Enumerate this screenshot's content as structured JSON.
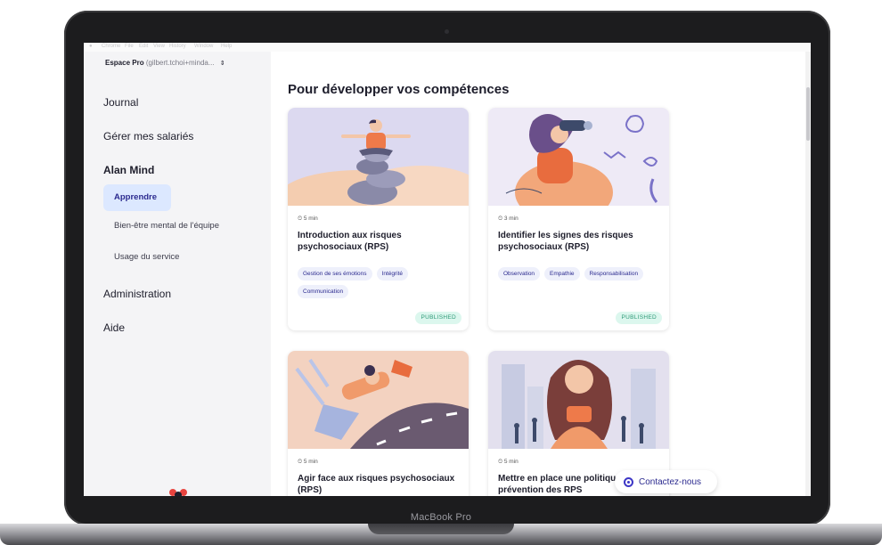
{
  "device": {
    "label": "MacBook Pro"
  },
  "menubar": {
    "items": [
      "Chrome",
      "File",
      "Edit",
      "View",
      "History",
      "Window",
      "Help"
    ]
  },
  "sidebar": {
    "workspace_name": "Espace Pro",
    "workspace_email": "(gilbert.tchoi+minda...",
    "workspace_chevron": "⇕",
    "items": [
      {
        "label": "Journal"
      },
      {
        "label": "Gérer mes salariés"
      },
      {
        "label": "Alan Mind"
      },
      {
        "label": "Administration"
      },
      {
        "label": "Aide"
      }
    ],
    "subitems": [
      {
        "label": "Apprendre"
      },
      {
        "label": "Bien-être mental de l'équipe"
      },
      {
        "label": "Usage du service"
      }
    ]
  },
  "main": {
    "heading": "Pour développer vos compétences",
    "cards": [
      {
        "duration": "5 min",
        "title": "Introduction aux risques psychosociaux (RPS)",
        "tags": [
          "Gestion de ses émotions",
          "Intégrité",
          "Communication"
        ],
        "status": "PUBLISHED"
      },
      {
        "duration": "3 min",
        "title": "Identifier les signes des risques psychosociaux (RPS)",
        "tags": [
          "Observation",
          "Empathie",
          "Responsabilisation"
        ],
        "status": "PUBLISHED"
      },
      {
        "duration": "5 min",
        "title": "Agir face aux risques psychosociaux (RPS)",
        "tags": [],
        "status": ""
      },
      {
        "duration": "5 min",
        "title": "Mettre en place une politique de prévention des RPS",
        "tags": [],
        "status": ""
      }
    ]
  },
  "contact_button": {
    "label": "Contactez-nous"
  },
  "colors": {
    "accent": "#2b2a8f",
    "active_bg": "#dce8ff",
    "published_text": "#2f9a78",
    "published_bg": "#dcf7ee"
  }
}
